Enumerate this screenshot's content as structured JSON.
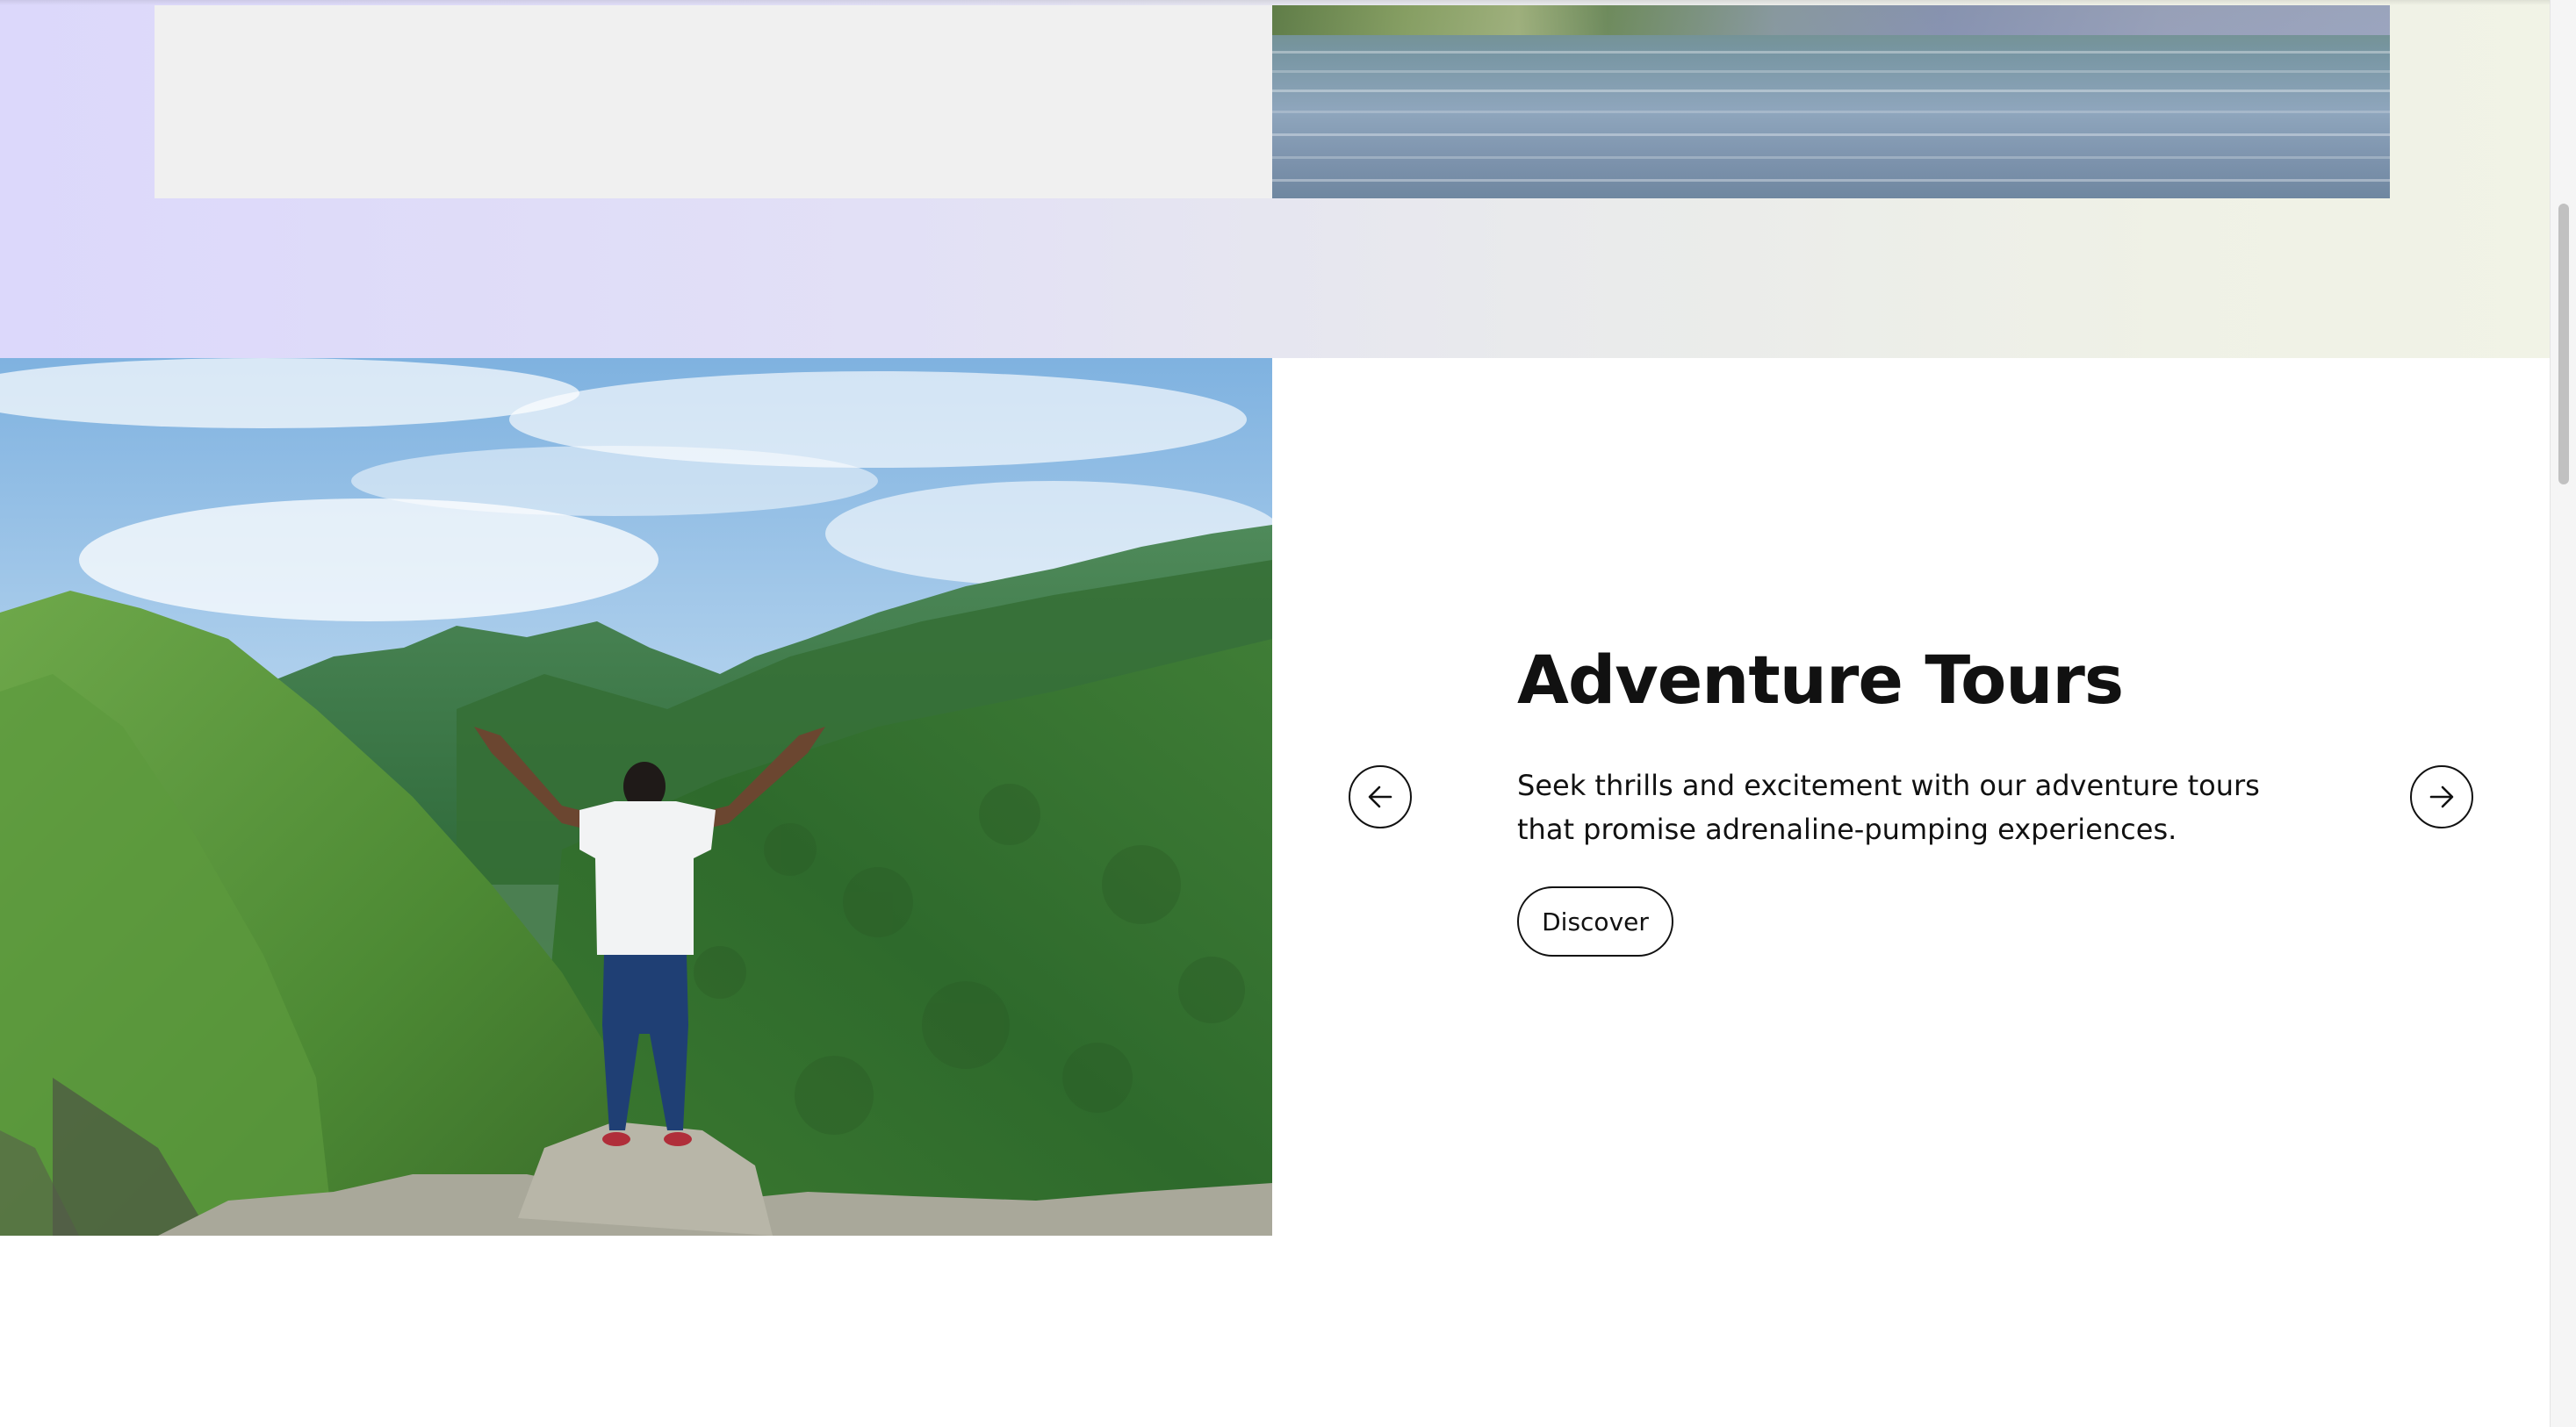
{
  "slide": {
    "title": "Adventure Tours",
    "description": "Seek thrills and excitement with our adventure tours that promise adrenaline-pumping experiences.",
    "button_label": "Discover",
    "image_icon": "mountain-photo"
  },
  "controls": {
    "prev_icon": "arrow-left-icon",
    "next_icon": "arrow-right-icon"
  },
  "colors": {
    "band_start": "#dcd8fb",
    "band_end": "#f1f3e6",
    "text": "#111111",
    "card_gray": "#f0f0f0"
  }
}
